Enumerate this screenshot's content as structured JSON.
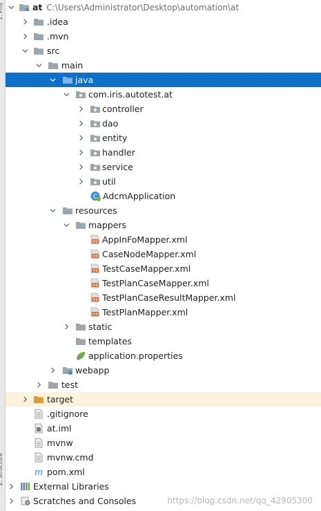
{
  "sidebar": {
    "tab_top": "1: Proj",
    "tab_bottom": "2: Structure"
  },
  "tree": {
    "root_name": "at",
    "root_path": "C:\\Users\\Administrator\\Desktop\\automation\\at",
    "idea": ".idea",
    "mvn": ".mvn",
    "src": "src",
    "main": "main",
    "java": "java",
    "package": "com.iris.autotest.at",
    "controller": "controller",
    "dao": "dao",
    "entity": "entity",
    "handler": "handler",
    "service": "service",
    "util": "util",
    "app_class": "AdcmApplication",
    "resources": "resources",
    "mappers": "mappers",
    "mapper_files": [
      "AppInFoMapper.xml",
      "CaseNodeMapper.xml",
      "TestCaseMapper.xml",
      "TestPlanCaseMapper.xml",
      "TestPlanCaseResultMapper.xml",
      "TestPlanMapper.xml"
    ],
    "static": "static",
    "templates": "templates",
    "app_props": "application.properties",
    "webapp": "webapp",
    "test": "test",
    "target": "target",
    "gitignore": ".gitignore",
    "iml": "at.iml",
    "mvnw": "mvnw",
    "mvnw_cmd": "mvnw.cmd",
    "pom": "pom.xml",
    "external_libraries": "External Libraries",
    "scratches": "Scratches and Consoles"
  },
  "watermark": "https://blog.csdn.net/qq_42905300",
  "colors": {
    "selection": "#0f70c9",
    "excluded_bg": "#fbf3dc",
    "folder": "#9aa7b0",
    "folder_blue": "#4a8bd4",
    "folder_orange": "#e39a3c"
  }
}
